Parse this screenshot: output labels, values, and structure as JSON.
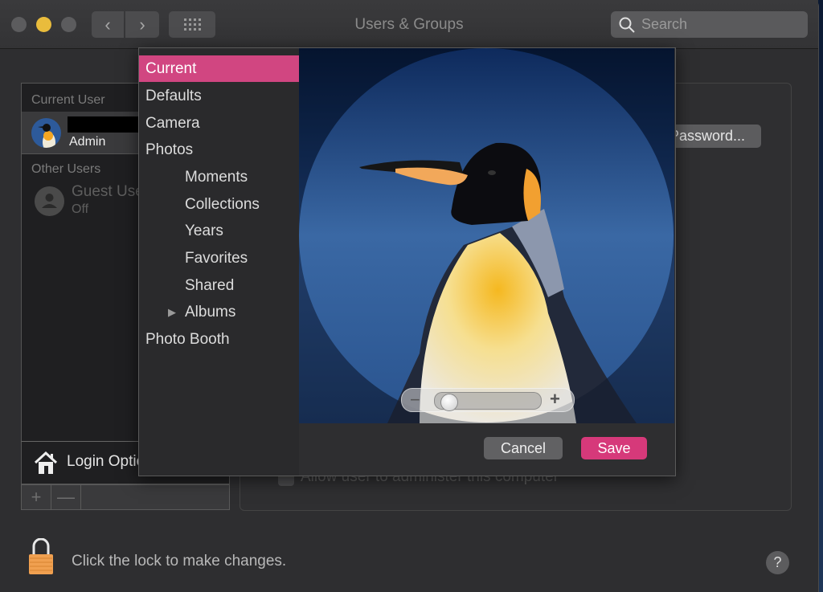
{
  "window": {
    "title": "Users & Groups",
    "nav": {
      "back_icon": "chevron-left-icon",
      "forward_icon": "chevron-right-icon",
      "grid_icon": "show-all-grid-icon"
    },
    "search": {
      "placeholder": "Search",
      "value": ""
    }
  },
  "users": {
    "current_header": "Current User",
    "current_user": {
      "name": "[redacted]",
      "role": "Admin"
    },
    "other_header": "Other Users",
    "others": [
      {
        "name": "Guest User",
        "status": "Off"
      }
    ],
    "login_options": "Login Options",
    "add_label": "+",
    "remove_label": "—"
  },
  "right_panel": {
    "password_button": "Password...",
    "admin_checkbox_label": "Allow user to administer this computer",
    "admin_checked": true
  },
  "footer": {
    "lock_text": "Click the lock to make changes.",
    "help_label": "?"
  },
  "picture_sheet": {
    "sources": [
      {
        "label": "Current",
        "selected": true,
        "indent": 0
      },
      {
        "label": "Defaults",
        "indent": 0
      },
      {
        "label": "Camera",
        "indent": 0
      },
      {
        "label": "Photos",
        "indent": 0
      },
      {
        "label": "Moments",
        "indent": 1
      },
      {
        "label": "Collections",
        "indent": 1
      },
      {
        "label": "Years",
        "indent": 1
      },
      {
        "label": "Favorites",
        "indent": 1
      },
      {
        "label": "Shared",
        "indent": 1
      },
      {
        "label": "Albums",
        "indent": 1,
        "disclosure": "▶"
      },
      {
        "label": "Photo Booth",
        "indent": 0
      }
    ],
    "image_subject": "king penguin",
    "zoom": {
      "minus": "−",
      "plus": "+",
      "value_fraction": 0.05
    },
    "cancel_label": "Cancel",
    "save_label": "Save",
    "accent_color": "#d6397a"
  }
}
